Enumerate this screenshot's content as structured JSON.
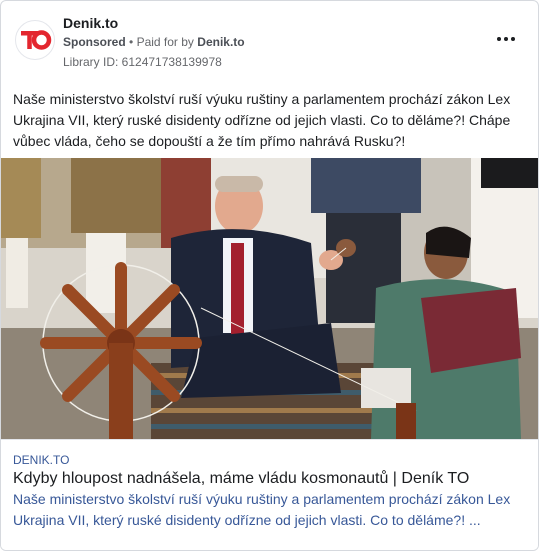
{
  "ad": {
    "page_name": "Denik.to",
    "sponsored_label": "Sponsored",
    "separator": "•",
    "paid_for_prefix": "Paid for by",
    "paid_for_name": "Denik.to",
    "library_id": "Library ID: 612471738139978",
    "logo_text": "TO",
    "post_text": "Naše ministerstvo školství ruší výuku ruštiny a parlamentem prochází zákon Lex Ukrajina VII, který ruské disidenty odřízne od jejich vlasti. Co to děláme?! Chápe vůbec vláda, čeho se dopouští a že tím přímo nahrává Rusku?!",
    "link": {
      "domain": "DENIK.TO",
      "title": "Kdyby hloupost nadnášela, máme vládu kosmonautů | Deník TO",
      "description": "Naše ministerstvo školství ruší výuku ruštiny a parlamentem prochází zákon Lex Ukrajina VII, který ruské disidenty odřízne od jejich vlasti. Co to děláme?! ..."
    }
  },
  "colors": {
    "brand_red": "#e3262f",
    "link_blue": "#385898",
    "muted": "#65676b"
  },
  "icons": {
    "more": "more-horizontal-icon",
    "logo": "denik-to-logo"
  }
}
